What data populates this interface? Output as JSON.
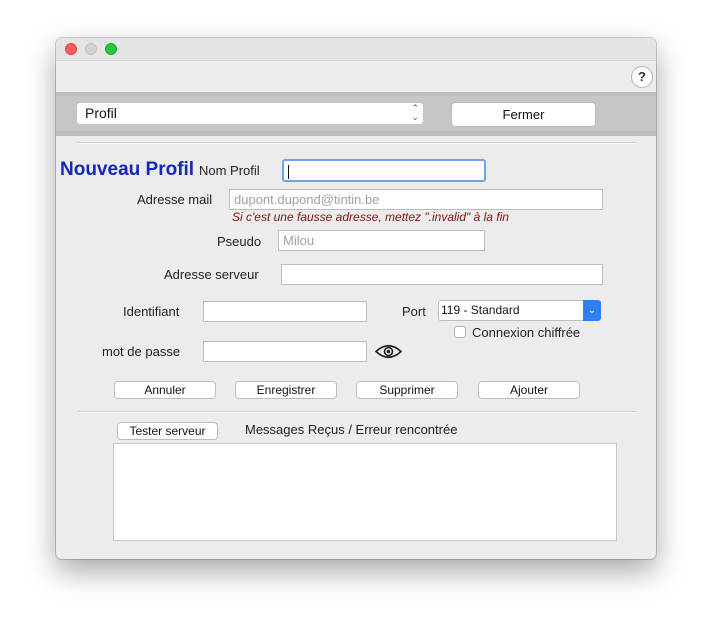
{
  "window": {
    "help_label": "?"
  },
  "toolbar": {
    "profile_select": "Profil",
    "close_button": "Fermer"
  },
  "form": {
    "title": "Nouveau Profil",
    "nom_profil_label": "Nom Profil",
    "nom_profil_value": "",
    "adresse_mail_label": "Adresse mail",
    "adresse_mail_placeholder": "dupont.dupond@tintin.be",
    "adresse_mail_hint": "Si c'est une fausse adresse, mettez \".invalid\" à la fin",
    "pseudo_label": "Pseudo",
    "pseudo_placeholder": "Milou",
    "adresse_serveur_label": "Adresse serveur",
    "identifiant_label": "Identifiant",
    "port_label": "Port",
    "port_value": "119 - Standard",
    "connexion_chiffree_label": "Connexion chiffrée",
    "connexion_chiffree_checked": false,
    "mot_de_passe_label": "mot de passe"
  },
  "actions": {
    "annuler": "Annuler",
    "enregistrer": "Enregistrer",
    "supprimer": "Supprimer",
    "ajouter": "Ajouter"
  },
  "server": {
    "test_button": "Tester serveur",
    "messages_label": "Messages Reçus / Erreur rencontrée",
    "messages_text": ""
  },
  "colors": {
    "title": "#1428b4",
    "hint": "#8a1010",
    "accent": "#2f7ff0",
    "close": "#ff5f57",
    "minimize": "#d0d0d0",
    "zoom": "#28c840"
  }
}
